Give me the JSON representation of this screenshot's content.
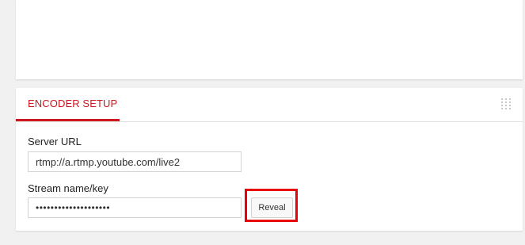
{
  "encoder_setup": {
    "title": "ENCODER SETUP",
    "server_url": {
      "label": "Server URL",
      "value": "rtmp://a.rtmp.youtube.com/live2"
    },
    "stream_key": {
      "label": "Stream name/key",
      "value": "••••••••••••••••••••"
    },
    "reveal_label": "Reveal"
  },
  "colors": {
    "accent": "#cc181e",
    "highlight": "#e8000b",
    "background": "#f1f1f1"
  },
  "icons": {
    "drag_handle": "drag-handle-icon"
  }
}
